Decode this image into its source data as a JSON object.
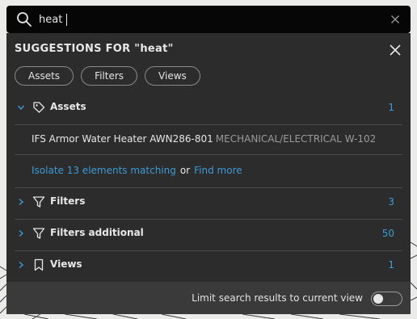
{
  "search": {
    "value": "heat",
    "icon": "search-icon",
    "clear_icon": "close-icon"
  },
  "panel": {
    "header": "SUGGESTIONS FOR \"heat\"",
    "close_icon": "close-icon",
    "chips": [
      "Assets",
      "Filters",
      "Views"
    ],
    "sections": [
      {
        "label": "Assets",
        "count": "1",
        "icon": "tag-icon",
        "expanded": true
      },
      {
        "label": "Filters",
        "count": "3",
        "icon": "filter-icon",
        "expanded": false
      },
      {
        "label": "Filters additional",
        "count": "50",
        "icon": "filter-icon",
        "expanded": false
      },
      {
        "label": "Views",
        "count": "1",
        "icon": "bookmark-icon",
        "expanded": false
      }
    ],
    "asset_result": {
      "name": "IFS Armor Water Heater AWN286-801",
      "category": "MECHANICAL/ELECTRICAL W-102"
    },
    "actions": {
      "isolate_link": "Isolate 13 elements matching",
      "or_text": "or",
      "find_more_link": "Find more"
    },
    "footer": {
      "label": "Limit search results to current view",
      "toggle_on": false
    }
  },
  "colors": {
    "accent": "#3c9ad6",
    "panel_bg": "#2c2c2c",
    "search_bg": "#060606",
    "footer_bg": "#3a3a3a"
  }
}
